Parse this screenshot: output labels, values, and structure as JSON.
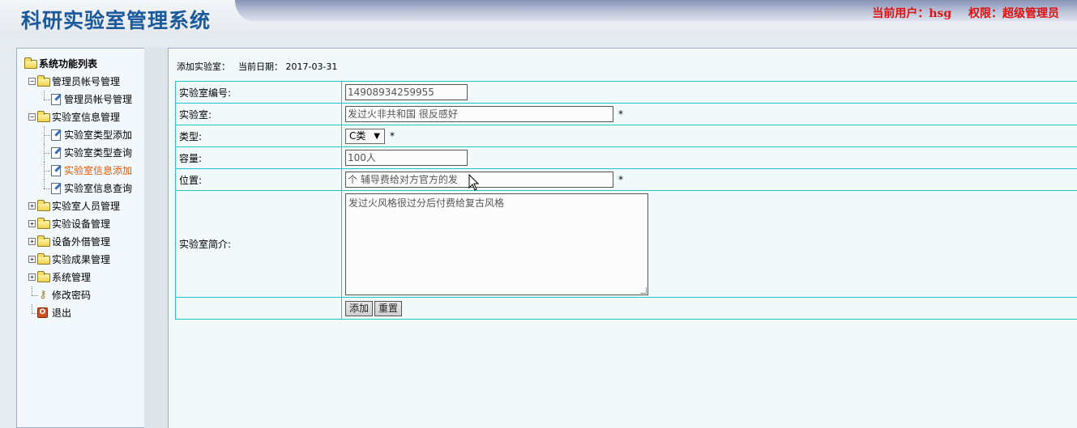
{
  "header": {
    "title": "科研实验室管理系统",
    "current_user": "当前用户：hsg",
    "permission": "权限：超级管理员"
  },
  "sidebar": {
    "root": "系统功能列表",
    "items": [
      {
        "label": "管理员帐号管理",
        "expanded": true,
        "children": [
          "管理员帐号管理"
        ]
      },
      {
        "label": "实验室信息管理",
        "expanded": true,
        "children": [
          "实验室类型添加",
          "实验室类型查询",
          "实验室信息添加",
          "实验室信息查询"
        ]
      },
      {
        "label": "实验室人员管理",
        "expanded": false
      },
      {
        "label": "实验设备管理",
        "expanded": false
      },
      {
        "label": "设备外借管理",
        "expanded": false
      },
      {
        "label": "实验成果管理",
        "expanded": false
      },
      {
        "label": "系统管理",
        "expanded": false
      }
    ],
    "change_password": "修改密码",
    "logout": "退出",
    "active_item": "实验室信息添加",
    "active_color": "#e05a00"
  },
  "main": {
    "breadcrumb_label": "添加实验室：",
    "date_label": "当前日期：",
    "date_value": "2017-03-31",
    "form": {
      "id_label": "实验室编号:",
      "id_value": "14908934259955",
      "name_label": "实验室:",
      "name_value": "发过火非共和国 很反感好",
      "type_label": "类型:",
      "type_value": "C类",
      "capacity_label": "容量:",
      "capacity_value": "100人",
      "location_label": "位置:",
      "location_value": "个 辅导费给对方官方的发",
      "intro_label": "实验室简介:",
      "intro_value": "发过火风格很过分后付费给复古风格",
      "required_mark": "*",
      "add_button": "添加",
      "reset_button": "重置"
    }
  },
  "colors": {
    "title": "#1a5a9c",
    "user_info": "#e01010",
    "table_border": "#22c4d4",
    "panel_bg": "#f1faf8"
  }
}
